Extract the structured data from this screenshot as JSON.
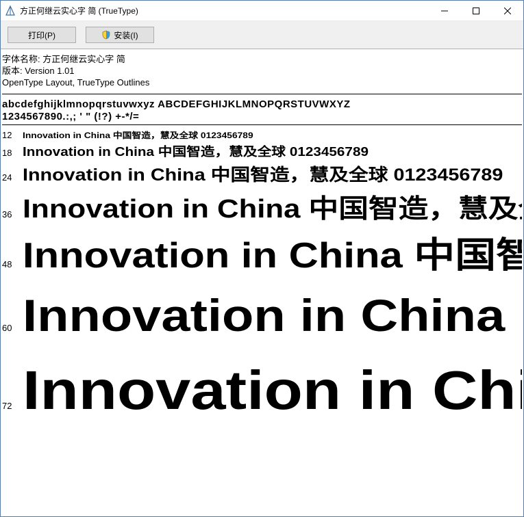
{
  "titlebar": {
    "title": "方正何继云实心字 简 (TrueType)"
  },
  "toolbar": {
    "print_label": "打印(P)",
    "install_label": "安装(I)"
  },
  "meta": {
    "name_label": "字体名称:",
    "name_value": "方正何继云实心字 简",
    "version_label": "版本:",
    "version_value": "Version 1.01",
    "layout": "OpenType Layout, TrueType Outlines"
  },
  "charset": {
    "line1": "abcdefghijklmnopqrstuvwxyz ABCDEFGHIJKLMNOPQRSTUVWXYZ",
    "line2": "1234567890.:,; ' \" (!?) +-*/="
  },
  "sample_text": "Innovation in China 中国智造，慧及全球 0123456789",
  "sizes": [
    {
      "label": "12",
      "class": "sz12"
    },
    {
      "label": "18",
      "class": "sz18"
    },
    {
      "label": "24",
      "class": "sz24"
    },
    {
      "label": "36",
      "class": "sz36"
    },
    {
      "label": "48",
      "class": "sz48"
    },
    {
      "label": "60",
      "class": "sz60"
    },
    {
      "label": "72",
      "class": "sz72"
    }
  ]
}
